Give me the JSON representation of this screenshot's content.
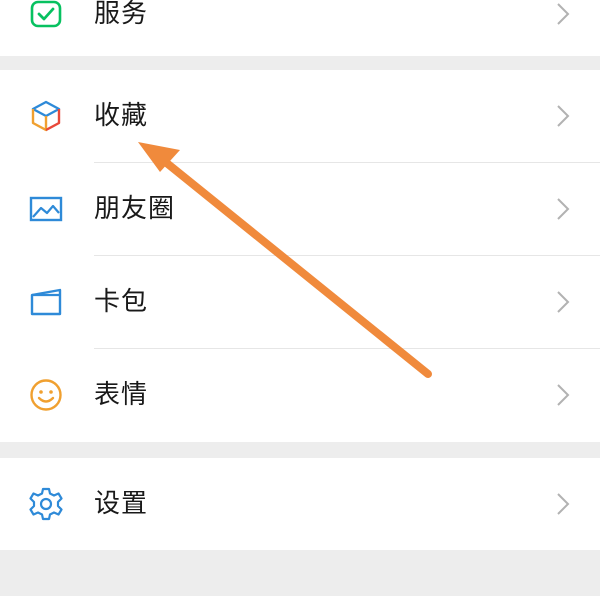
{
  "menu": {
    "services_label": "服务",
    "favorites_label": "收藏",
    "moments_label": "朋友圈",
    "cards_label": "卡包",
    "stickers_label": "表情",
    "settings_label": "设置"
  },
  "icons": {
    "services": "wallet-check-icon",
    "favorites": "cube-icon",
    "moments": "photo-icon",
    "cards": "card-wallet-icon",
    "stickers": "smiley-icon",
    "settings": "gear-icon",
    "chevron": "chevron-right-icon"
  },
  "colors": {
    "background": "#ededed",
    "row_background": "#ffffff",
    "text": "#191919",
    "chevron": "#b2b2b2",
    "green": "#07c160",
    "blue": "#2e8ad8",
    "amber": "#f0a030",
    "annotation_arrow": "#f08a3c"
  }
}
